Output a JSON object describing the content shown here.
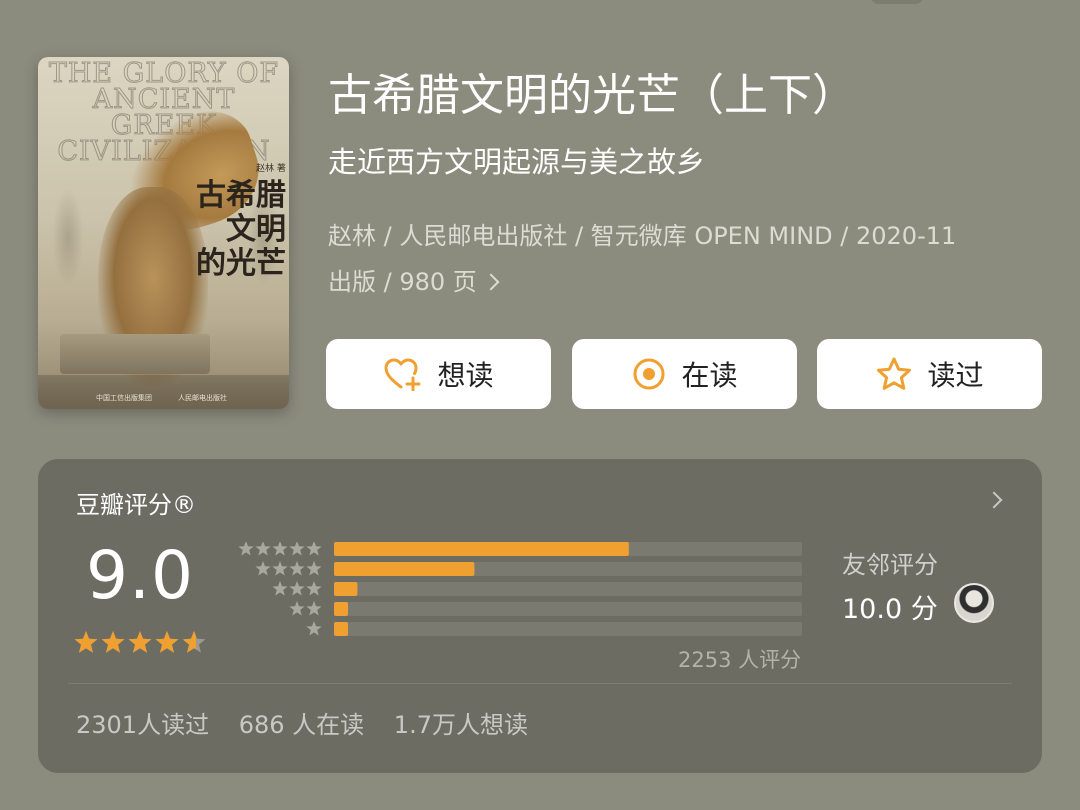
{
  "book": {
    "title": "古希腊文明的光芒（上下）",
    "subtitle": "走近西方文明起源与美之故乡",
    "meta_line1": "赵林 / 人民邮电出版社 / 智元微库 OPEN MIND / 2020-11",
    "meta_line2": "出版 / 980 页"
  },
  "cover": {
    "title_en": "THE GLORY OF ANCIENT GREEK CIVILIZATION",
    "author": "赵林 著",
    "title_cn_lines": [
      "古希腊",
      "文明",
      "的光芒"
    ],
    "publisher_left": "中国工信出版集团",
    "publisher_right": "人民邮电出版社"
  },
  "actions": {
    "want_read": "想读",
    "reading": "在读",
    "have_read": "读过",
    "accent_color": "#f0a030"
  },
  "rating": {
    "header": "豆瓣评分®",
    "score": "9.0",
    "stars": 4.5,
    "rating_count": "2253 人评分",
    "distribution": [
      {
        "stars": 5,
        "fraction": 0.63
      },
      {
        "stars": 4,
        "fraction": 0.3
      },
      {
        "stars": 3,
        "fraction": 0.05
      },
      {
        "stars": 2,
        "fraction": 0.03
      },
      {
        "stars": 1,
        "fraction": 0.03
      }
    ],
    "friends_label": "友邻评分",
    "friends_score": "10.0 分",
    "bar_color": "#f0a030",
    "bar_track_color": "#7a7a70"
  },
  "stats": {
    "read": "2301人读过",
    "reading": "686 人在读",
    "want": "1.7万人想读"
  }
}
